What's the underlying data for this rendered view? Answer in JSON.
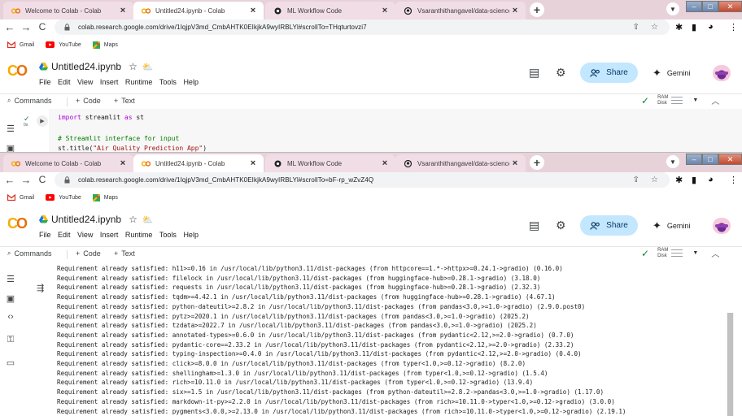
{
  "colors": {
    "tabbar": "#e8d2da",
    "share_bg": "#c2e7ff",
    "colab_orange": "#f9ab00",
    "ok_green": "#188038"
  },
  "bookmarks": [
    {
      "label": "Gmail",
      "icon": "gmail-icon"
    },
    {
      "label": "YouTube",
      "icon": "youtube-icon"
    },
    {
      "label": "Maps",
      "icon": "maps-icon"
    }
  ],
  "tabs": [
    {
      "label": "Welcome to Colab - Colab",
      "icon": "colab-icon"
    },
    {
      "label": "Untitled24.ipynb - Colab",
      "icon": "colab-icon"
    },
    {
      "label": "ML Workflow Code",
      "icon": "chatgpt-icon"
    },
    {
      "label": "Vsaranthithangavel/data-science",
      "icon": "github-icon"
    }
  ],
  "tabs2": [
    {
      "label": "Welcome to Colab - Colab"
    },
    {
      "label": "Untitled24.ipynb - Colab"
    },
    {
      "label": "ML Workflow Code"
    },
    {
      "label": "Vsaranthithangavel/data-science"
    }
  ],
  "win1": {
    "url": "colab.research.google.com/drive/1IqjpV3md_CmbAHTK0EIkjkA9wyIRBLYl#scrollTo=THqturtovzi7"
  },
  "win2": {
    "url": "colab.research.google.com/drive/1IqjpV3md_CmbAHTK0EIkjkA9wyIRBLYl#scrollTo=bF-rp_wZvZ4Q"
  },
  "colab": {
    "logo": "CO",
    "title": "Untitled24.ipynb",
    "menu": [
      "File",
      "Edit",
      "View",
      "Insert",
      "Runtime",
      "Tools",
      "Help"
    ],
    "share_label": "Share",
    "gemini_label": "Gemini",
    "commands_label": "Commands",
    "code_label": "Code",
    "text_label": "Text",
    "ram_label": "RAM",
    "disk_label": "Disk"
  },
  "cell1": {
    "exec": "0s",
    "line1_kw": "import",
    "line1_rest": " streamlit ",
    "line1_as": "as",
    "line1_alias": " st",
    "line2": "# Streamlit interface for input",
    "line3a": "st.title(",
    "line3b": "\"Air Quality Prediction App\"",
    "line3c": ")"
  },
  "output_lines": [
    "Requirement already satisfied: h11>=0.16 in /usr/local/lib/python3.11/dist-packages (from httpcore==1.*->httpx>=0.24.1->gradio) (0.16.0)",
    "Requirement already satisfied: filelock in /usr/local/lib/python3.11/dist-packages (from huggingface-hub>=0.28.1->gradio) (3.18.0)",
    "Requirement already satisfied: requests in /usr/local/lib/python3.11/dist-packages (from huggingface-hub>=0.28.1->gradio) (2.32.3)",
    "Requirement already satisfied: tqdm>=4.42.1 in /usr/local/lib/python3.11/dist-packages (from huggingface-hub>=0.28.1->gradio) (4.67.1)",
    "Requirement already satisfied: python-dateutil>=2.8.2 in /usr/local/lib/python3.11/dist-packages (from pandas<3.0,>=1.0->gradio) (2.9.0.post0)",
    "Requirement already satisfied: pytz>=2020.1 in /usr/local/lib/python3.11/dist-packages (from pandas<3.0,>=1.0->gradio) (2025.2)",
    "Requirement already satisfied: tzdata>=2022.7 in /usr/local/lib/python3.11/dist-packages (from pandas<3.0,>=1.0->gradio) (2025.2)",
    "Requirement already satisfied: annotated-types>=0.6.0 in /usr/local/lib/python3.11/dist-packages (from pydantic<2.12,>=2.0->gradio) (0.7.0)",
    "Requirement already satisfied: pydantic-core==2.33.2 in /usr/local/lib/python3.11/dist-packages (from pydantic<2.12,>=2.0->gradio) (2.33.2)",
    "Requirement already satisfied: typing-inspection>=0.4.0 in /usr/local/lib/python3.11/dist-packages (from pydantic<2.12,>=2.0->gradio) (0.4.0)",
    "Requirement already satisfied: click>=8.0.0 in /usr/local/lib/python3.11/dist-packages (from typer<1.0,>=0.12->gradio) (8.2.0)",
    "Requirement already satisfied: shellingham>=1.3.0 in /usr/local/lib/python3.11/dist-packages (from typer<1.0,>=0.12->gradio) (1.5.4)",
    "Requirement already satisfied: rich>=10.11.0 in /usr/local/lib/python3.11/dist-packages (from typer<1.0,>=0.12->gradio) (13.9.4)",
    "Requirement already satisfied: six>=1.5 in /usr/local/lib/python3.11/dist-packages (from python-dateutil>=2.8.2->pandas<3.0,>=1.0->gradio) (1.17.0)",
    "Requirement already satisfied: markdown-it-py>=2.2.0 in /usr/local/lib/python3.11/dist-packages (from rich>=10.11.0->typer<1.0,>=0.12->gradio) (3.0.0)",
    "Requirement already satisfied: pygments<3.0.0,>=2.13.0 in /usr/local/lib/python3.11/dist-packages (from rich>=10.11.0->typer<1.0,>=0.12->gradio) (2.19.1)"
  ]
}
